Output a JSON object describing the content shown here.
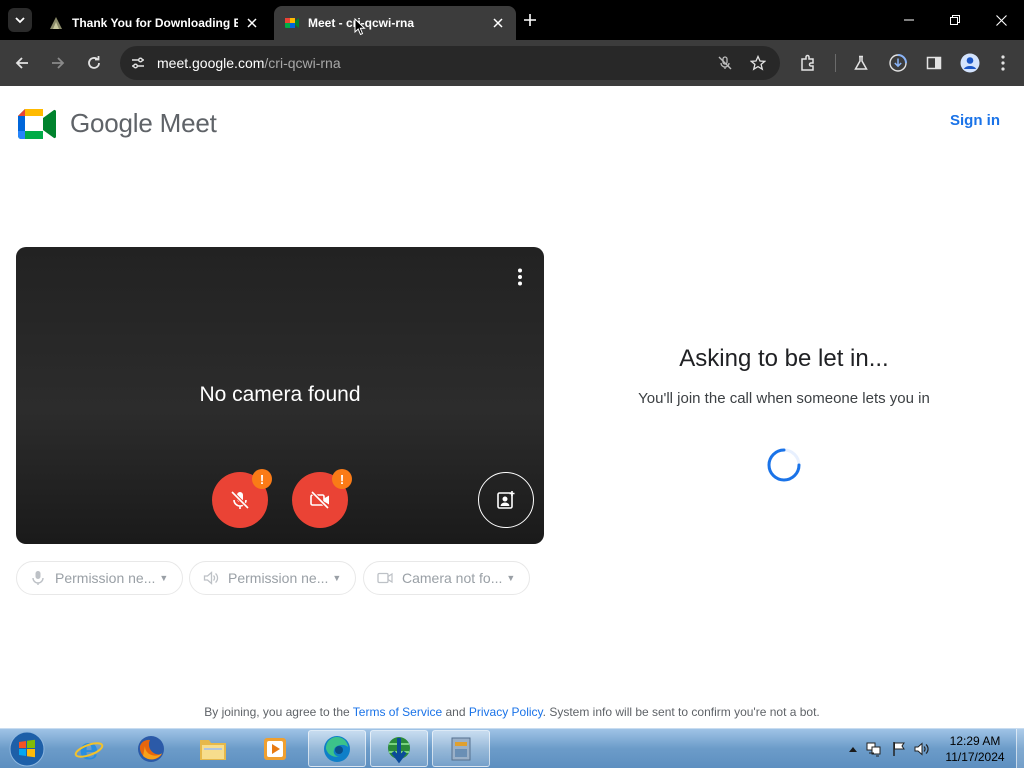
{
  "browser": {
    "tabs": [
      {
        "title": "Thank You for Downloading Ea",
        "icon": "downloads-page-icon",
        "active": false
      },
      {
        "title": "Meet - cri-qcwi-rna",
        "icon": "google-meet-icon",
        "active": true
      }
    ],
    "url_host": "meet.google.com",
    "url_path": "/cri-qcwi-rna"
  },
  "header": {
    "logo_text": "Google Meet",
    "sign_in": "Sign in"
  },
  "preview": {
    "message": "No camera found",
    "warning_badge": "!"
  },
  "chips": [
    {
      "label": "Permission ne...",
      "icon": "microphone-icon"
    },
    {
      "label": "Permission ne...",
      "icon": "speaker-icon"
    },
    {
      "label": "Camera not fo...",
      "icon": "camera-icon"
    }
  ],
  "status": {
    "title": "Asking to be let in...",
    "subtitle": "You'll join the call when someone lets you in"
  },
  "footer": {
    "prefix": "By joining, you agree to the",
    "terms": "Terms of Service",
    "and": "and",
    "privacy": "Privacy Policy",
    "suffix": ". System info will be sent to confirm you're not a bot."
  },
  "taskbar": {
    "time": "12:29 AM",
    "date": "11/17/2024"
  },
  "colors": {
    "accent": "#1a73e8",
    "danger": "#ea4335",
    "warning": "#fa7b17",
    "chrome_dark": "#3c3c3c"
  }
}
